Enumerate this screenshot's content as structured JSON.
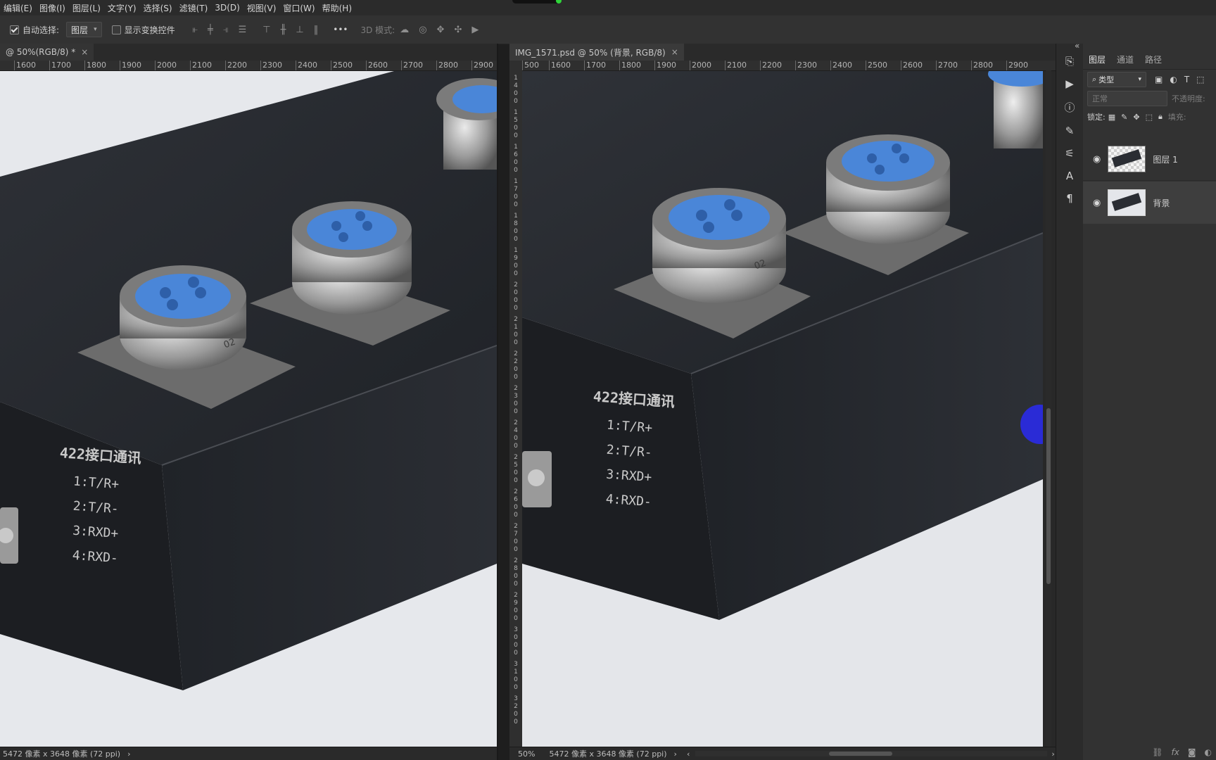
{
  "menubar": {
    "items": [
      "编辑(E)",
      "图像(I)",
      "图层(L)",
      "文字(Y)",
      "选择(S)",
      "滤镜(T)",
      "3D(D)",
      "视图(V)",
      "窗口(W)",
      "帮助(H)"
    ]
  },
  "options": {
    "auto_select_label": "自动选择:",
    "auto_select_value": "图层",
    "show_transform_label": "显示变换控件",
    "more_label": "•••",
    "mode_3d_label": "3D 模式:"
  },
  "left_doc": {
    "tab_title": "@ 50%(RGB/8) *",
    "tab_close": "×",
    "ruler_labels": [
      "1600",
      "1700",
      "1800",
      "1900",
      "2000",
      "2100",
      "2200",
      "2300",
      "2400",
      "2500",
      "2600",
      "2700",
      "2800",
      "2900"
    ],
    "status": "5472 像素 x 3648 像素 (72 ppi)",
    "status_arrow": "›",
    "label_title": "422接口通讯",
    "label_line1": "1:T/R+",
    "label_line2": "2:T/R-",
    "label_line3": "3:RXD+",
    "label_line4": "4:RXD-",
    "connector_text": "02"
  },
  "right_doc": {
    "tab_title": "IMG_1571.psd @ 50% (背景, RGB/8)",
    "tab_close": "×",
    "ruler_labels": [
      "500",
      "1600",
      "1700",
      "1800",
      "1900",
      "2000",
      "2100",
      "2200",
      "2300",
      "2400",
      "2500",
      "2600",
      "2700",
      "2800",
      "2900"
    ],
    "vruler_digits": [
      "1",
      "4",
      "0",
      "0",
      "1",
      "5",
      "0",
      "0",
      "1",
      "6",
      "0",
      "0",
      "1",
      "7",
      "0",
      "0",
      "1",
      "8",
      "0",
      "0",
      "1",
      "9",
      "0",
      "0",
      "2",
      "0",
      "0",
      "0",
      "2",
      "1",
      "0",
      "0",
      "2",
      "2",
      "0",
      "0",
      "2",
      "3",
      "0",
      "0",
      "2",
      "4",
      "0",
      "0",
      "2",
      "5",
      "0",
      "0",
      "2",
      "6",
      "0",
      "0",
      "2",
      "7",
      "0",
      "0",
      "2",
      "8",
      "0",
      "0",
      "2",
      "9",
      "0",
      "0",
      "3",
      "0",
      "0",
      "0",
      "3",
      "1",
      "0",
      "0",
      "3",
      "2",
      "0",
      "0"
    ],
    "zoom": "50%",
    "status": "5472 像素 x 3648 像素 (72 ppi)",
    "status_arrow": "›",
    "scroll_left_arrow": "‹",
    "scroll_right_arrow": "›",
    "label_title": "422接口通讯",
    "label_line1": "1:T/R+",
    "label_line2": "2:T/R-",
    "label_line3": "3:RXD+",
    "label_line4": "4:RXD-",
    "connector_text": "02"
  },
  "layers_panel": {
    "collapse_glyph": "«",
    "tabs": [
      "图层",
      "通道",
      "路径"
    ],
    "filter_label": "类型",
    "blend_mode": "正常",
    "opacity_label": "不透明度:",
    "lock_label": "锁定:",
    "fill_label": "填充:",
    "layers": [
      {
        "name": "图层 1",
        "selected": false
      },
      {
        "name": "背景",
        "selected": true
      }
    ],
    "footer_icons": [
      "link-icon",
      "fx-icon",
      "mask-icon",
      "adjustment-icon"
    ],
    "fx_label": "fx"
  },
  "colors": {
    "accent_blue": "#2a2bd6",
    "connector_blue": "#4a86d8",
    "device_black": "#24272c",
    "background_grey": "#e4e6ea"
  }
}
